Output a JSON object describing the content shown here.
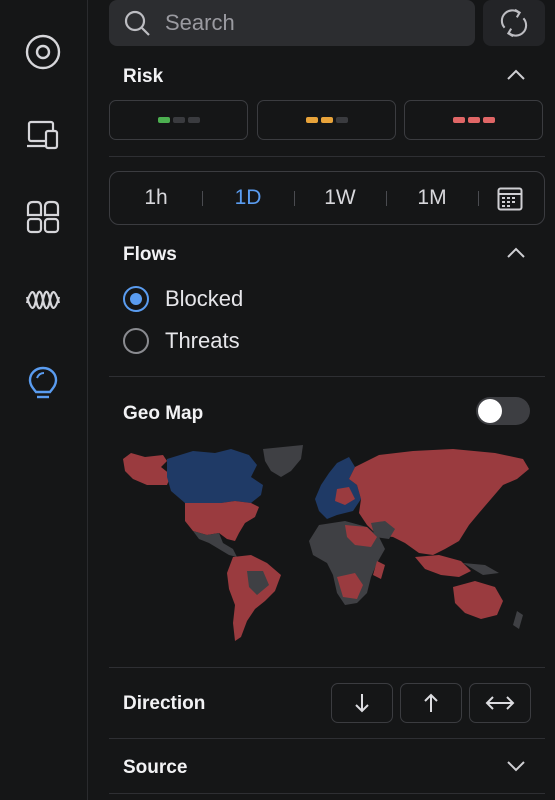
{
  "sidebar": {
    "icons": [
      {
        "name": "overview-icon",
        "active": false
      },
      {
        "name": "devices-icon",
        "active": false
      },
      {
        "name": "apps-icon",
        "active": false
      },
      {
        "name": "traffic-wave-icon",
        "active": false
      },
      {
        "name": "insights-bulb-icon",
        "active": true
      }
    ]
  },
  "search": {
    "placeholder": "Search"
  },
  "risk": {
    "title": "Risk",
    "levels": [
      {
        "name": "low",
        "color": "#4caf50",
        "filled": 1
      },
      {
        "name": "medium",
        "color": "#e8a33a",
        "filled": 2
      },
      {
        "name": "high",
        "color": "#e06666",
        "filled": 3
      }
    ]
  },
  "time_range": {
    "options": [
      "1h",
      "1D",
      "1W",
      "1M"
    ],
    "selected": "1D"
  },
  "flows": {
    "title": "Flows",
    "options": [
      {
        "label": "Blocked",
        "checked": true
      },
      {
        "label": "Threats",
        "checked": false
      }
    ]
  },
  "geo_map": {
    "title": "Geo Map",
    "enabled": false
  },
  "direction": {
    "title": "Direction",
    "buttons": [
      "down-arrow-icon",
      "up-arrow-icon",
      "bidirectional-arrow-icon"
    ]
  },
  "source": {
    "title": "Source"
  },
  "colors": {
    "accent": "#5a9cf0",
    "map_blocked": "#9a3b3f",
    "map_allowed": "#1f3a66",
    "map_neutral": "#3f4044"
  }
}
